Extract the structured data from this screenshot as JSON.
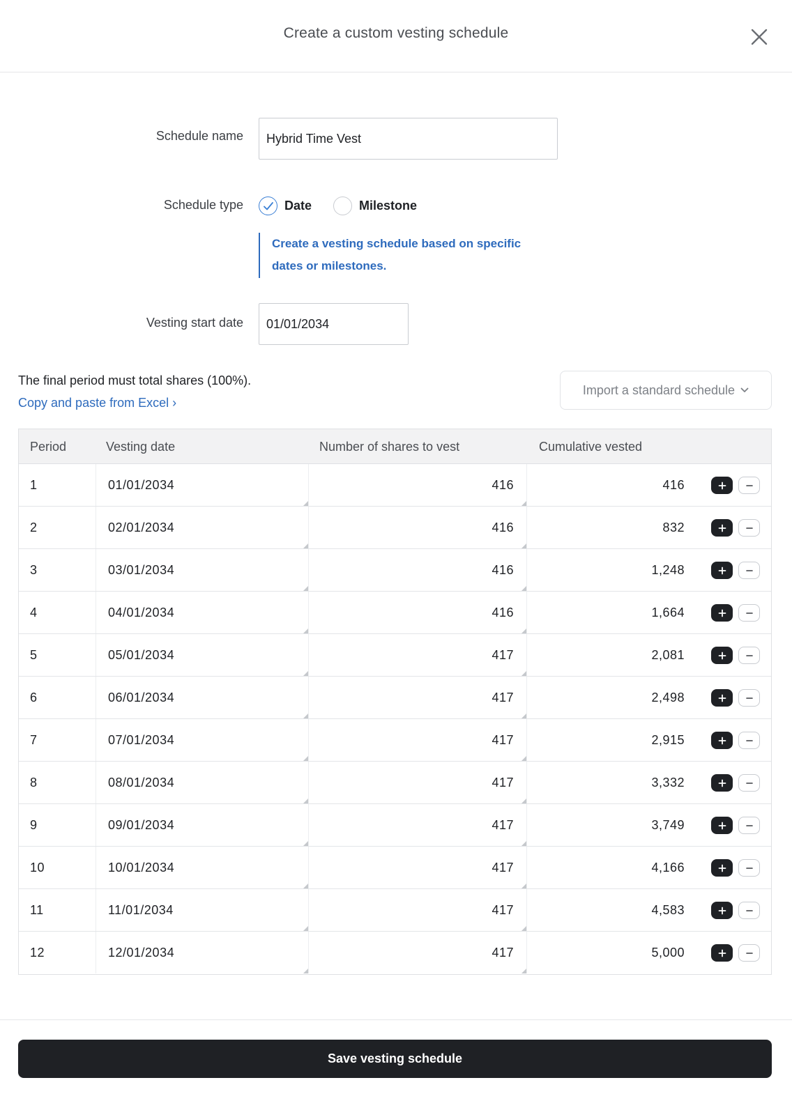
{
  "modal": {
    "title": "Create a custom vesting schedule",
    "close_icon": "close-icon"
  },
  "form": {
    "schedule_name_label": "Schedule name",
    "schedule_name_value": "Hybrid Time Vest",
    "schedule_type_label": "Schedule type",
    "schedule_type_options": [
      {
        "label": "Date",
        "selected": true
      },
      {
        "label": "Milestone",
        "selected": false
      }
    ],
    "hint_text": "Create a vesting schedule based on specific dates or milestones.",
    "vesting_start_label": "Vesting start date",
    "vesting_start_value": "01/01/2034"
  },
  "schedule": {
    "final_note": "The final period must total shares (100%).",
    "excel_link": "Copy and paste from Excel ›",
    "import_button": "Import a standard schedule",
    "columns": [
      "Period",
      "Vesting date",
      "Number of shares to vest",
      "Cumulative vested"
    ],
    "rows": [
      {
        "period": "1",
        "date": "01/01/2034",
        "shares": "416",
        "cumulative": "416"
      },
      {
        "period": "2",
        "date": "02/01/2034",
        "shares": "416",
        "cumulative": "832"
      },
      {
        "period": "3",
        "date": "03/01/2034",
        "shares": "416",
        "cumulative": "1,248"
      },
      {
        "period": "4",
        "date": "04/01/2034",
        "shares": "416",
        "cumulative": "1,664"
      },
      {
        "period": "5",
        "date": "05/01/2034",
        "shares": "417",
        "cumulative": "2,081"
      },
      {
        "period": "6",
        "date": "06/01/2034",
        "shares": "417",
        "cumulative": "2,498"
      },
      {
        "period": "7",
        "date": "07/01/2034",
        "shares": "417",
        "cumulative": "2,915"
      },
      {
        "period": "8",
        "date": "08/01/2034",
        "shares": "417",
        "cumulative": "3,332"
      },
      {
        "period": "9",
        "date": "09/01/2034",
        "shares": "417",
        "cumulative": "3,749"
      },
      {
        "period": "10",
        "date": "10/01/2034",
        "shares": "417",
        "cumulative": "4,166"
      },
      {
        "period": "11",
        "date": "11/01/2034",
        "shares": "417",
        "cumulative": "4,583"
      },
      {
        "period": "12",
        "date": "12/01/2034",
        "shares": "417",
        "cumulative": "5,000"
      }
    ],
    "add_row_icon": "plus-icon",
    "remove_row_icon": "minus-icon"
  },
  "footer": {
    "save_label": "Save vesting schedule"
  },
  "colors": {
    "primary_dark": "#1f2125",
    "link_blue": "#2e6bbd",
    "radio_check_blue": "#3a7fd5"
  }
}
